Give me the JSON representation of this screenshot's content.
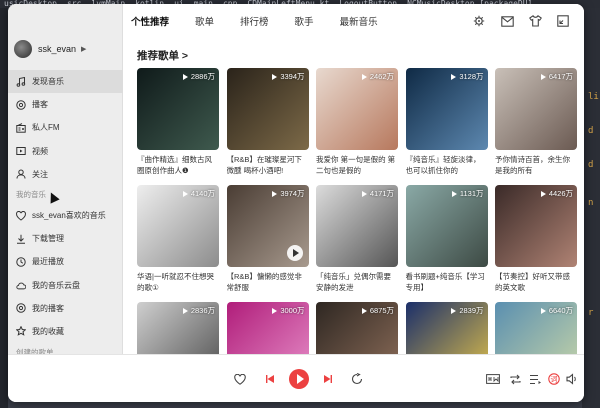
{
  "desktop": {
    "menubar": [
      "usicDesktop",
      "src",
      "lvmMain",
      "kotlin",
      "ui",
      "main",
      "cpp",
      "CDMainLeftMenu.kt",
      "LogoutButton",
      "NCMusicDesktop [packageDU]"
    ],
    "marks": [
      "li",
      "d",
      "d",
      "n",
      "r"
    ]
  },
  "sidebar": {
    "username": "ssk_evan",
    "items": [
      {
        "label": "发现音乐",
        "icon": "music-note-icon",
        "active": true
      },
      {
        "label": "播客",
        "icon": "podcast-icon"
      },
      {
        "label": "私人FM",
        "icon": "radio-icon"
      },
      {
        "label": "视频",
        "icon": "video-icon"
      },
      {
        "label": "关注",
        "icon": "user-follow-icon"
      }
    ],
    "section_my_music": "我的音乐",
    "my_items": [
      {
        "label": "ssk_evan喜欢的音乐",
        "icon": "heart-icon"
      },
      {
        "label": "下载管理",
        "icon": "download-icon"
      },
      {
        "label": "最近播放",
        "icon": "clock-icon"
      },
      {
        "label": "我的音乐云盘",
        "icon": "cloud-icon"
      },
      {
        "label": "我的播客",
        "icon": "podcast-icon"
      },
      {
        "label": "我的收藏",
        "icon": "star-icon"
      }
    ],
    "section_created": "创建的歌单"
  },
  "topbar": {
    "tabs": [
      "个性推荐",
      "歌单",
      "排行榜",
      "歌手",
      "最新音乐"
    ]
  },
  "content": {
    "section_title": "推荐歌单 >",
    "playlists": [
      {
        "plays": "2886万",
        "caption": "『曲作精选』细数古风圈原创作曲人❶",
        "c1": "#0f1a1a",
        "c2": "#3f5a4e"
      },
      {
        "plays": "3394万",
        "caption": "【R&B】在璀璨星河下微醺 喝杯小酒吧!",
        "c1": "#2a231a",
        "c2": "#7d6a48"
      },
      {
        "plays": "2462万",
        "caption": "我爱你 第一句是假的 第二句也是假的",
        "c1": "#e8d9cf",
        "c2": "#b7785d"
      },
      {
        "plays": "3128万",
        "caption": "『纯音乐』轻旋淡律，也可以抓住你的",
        "c1": "#0f2a45",
        "c2": "#5d88b0"
      },
      {
        "plays": "6417万",
        "caption": "予你情诗百首，余生你是我的所有",
        "c1": "#c9c0b8",
        "c2": "#6b5a52"
      },
      {
        "plays": "4140万",
        "caption": "华语|一听就忍不住想哭的歌①",
        "c1": "#eeeeee",
        "c2": "#8c8c8c"
      },
      {
        "plays": "3974万",
        "caption": "【R&B】慵懒的感觉非常舒服",
        "c1": "#4a3d34",
        "c2": "#a89a8e",
        "play": true
      },
      {
        "plays": "4171万",
        "caption": "「纯音乐」兑偶尔需要安静的发泄",
        "c1": "#dcdcdc",
        "c2": "#555555"
      },
      {
        "plays": "1131万",
        "caption": "看书刷题+纯音乐【学习专用】",
        "c1": "#8aa9a6",
        "c2": "#3d4a44"
      },
      {
        "plays": "4426万",
        "caption": "【节奏控】好听又带感的英文歌",
        "c1": "#3a2a28",
        "c2": "#b08374"
      },
      {
        "plays": "2836万",
        "caption": "",
        "c1": "#cfcfcf",
        "c2": "#4d4d4d"
      },
      {
        "plays": "3000万",
        "caption": "",
        "c1": "#b01d7a",
        "c2": "#e68ec8"
      },
      {
        "plays": "6875万",
        "caption": "",
        "c1": "#2e2722",
        "c2": "#8e6e5a"
      },
      {
        "plays": "2839万",
        "caption": "",
        "c1": "#1b2f6a",
        "c2": "#e2c24a"
      },
      {
        "plays": "6640万",
        "caption": "",
        "c1": "#5a8fb0",
        "c2": "#c9d6a8"
      }
    ]
  },
  "player": {
    "accent": "#ec4141"
  }
}
